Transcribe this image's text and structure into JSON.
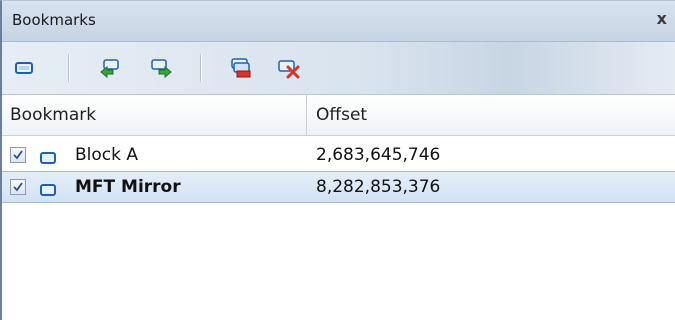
{
  "window": {
    "title": "Bookmarks",
    "close_label": "x"
  },
  "toolbar": {
    "buttons": [
      {
        "name": "bookmark-icon",
        "tooltip": ""
      },
      {
        "name": "previous-bookmark-icon",
        "tooltip": ""
      },
      {
        "name": "next-bookmark-icon",
        "tooltip": ""
      },
      {
        "name": "delete-bookmark-icon",
        "tooltip": ""
      },
      {
        "name": "clear-bookmarks-icon",
        "tooltip": ""
      }
    ]
  },
  "table": {
    "columns": [
      "Bookmark",
      "Offset"
    ],
    "rows": [
      {
        "name": "Block A",
        "offset": "2,683,645,746",
        "checked": true,
        "selected": false
      },
      {
        "name": "MFT Mirror",
        "offset": "8,282,853,376",
        "checked": true,
        "selected": true
      }
    ]
  },
  "colors": {
    "accent": "#2f6fcf",
    "selection": "#d3e2f4"
  }
}
